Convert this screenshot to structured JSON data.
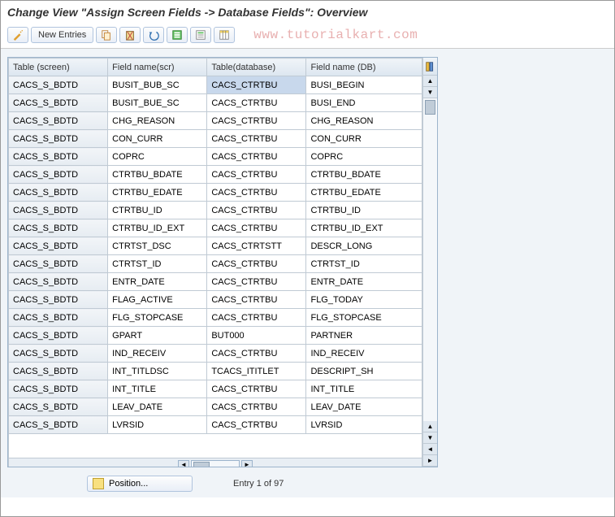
{
  "title": "Change View \"Assign Screen Fields -> Database Fields\": Overview",
  "toolbar": {
    "wand_label": "",
    "new_entries_label": "New Entries"
  },
  "watermark": "www.tutorialkart.com",
  "columns": {
    "c0": "Table (screen)",
    "c1": "Field name(scr)",
    "c2": "Table(database)",
    "c3": "Field name (DB)"
  },
  "selected_cell": {
    "row": 0,
    "col": 2
  },
  "rows": [
    {
      "c0": "CACS_S_BDTD",
      "c1": "BUSIT_BUB_SC",
      "c2": "CACS_CTRTBU",
      "c3": "BUSI_BEGIN"
    },
    {
      "c0": "CACS_S_BDTD",
      "c1": "BUSIT_BUE_SC",
      "c2": "CACS_CTRTBU",
      "c3": "BUSI_END"
    },
    {
      "c0": "CACS_S_BDTD",
      "c1": "CHG_REASON",
      "c2": "CACS_CTRTBU",
      "c3": "CHG_REASON"
    },
    {
      "c0": "CACS_S_BDTD",
      "c1": "CON_CURR",
      "c2": "CACS_CTRTBU",
      "c3": "CON_CURR"
    },
    {
      "c0": "CACS_S_BDTD",
      "c1": "COPRC",
      "c2": "CACS_CTRTBU",
      "c3": "COPRC"
    },
    {
      "c0": "CACS_S_BDTD",
      "c1": "CTRTBU_BDATE",
      "c2": "CACS_CTRTBU",
      "c3": "CTRTBU_BDATE"
    },
    {
      "c0": "CACS_S_BDTD",
      "c1": "CTRTBU_EDATE",
      "c2": "CACS_CTRTBU",
      "c3": "CTRTBU_EDATE"
    },
    {
      "c0": "CACS_S_BDTD",
      "c1": "CTRTBU_ID",
      "c2": "CACS_CTRTBU",
      "c3": "CTRTBU_ID"
    },
    {
      "c0": "CACS_S_BDTD",
      "c1": "CTRTBU_ID_EXT",
      "c2": "CACS_CTRTBU",
      "c3": "CTRTBU_ID_EXT"
    },
    {
      "c0": "CACS_S_BDTD",
      "c1": "CTRTST_DSC",
      "c2": "CACS_CTRTSTT",
      "c3": "DESCR_LONG"
    },
    {
      "c0": "CACS_S_BDTD",
      "c1": "CTRTST_ID",
      "c2": "CACS_CTRTBU",
      "c3": "CTRTST_ID"
    },
    {
      "c0": "CACS_S_BDTD",
      "c1": "ENTR_DATE",
      "c2": "CACS_CTRTBU",
      "c3": "ENTR_DATE"
    },
    {
      "c0": "CACS_S_BDTD",
      "c1": "FLAG_ACTIVE",
      "c2": "CACS_CTRTBU",
      "c3": "FLG_TODAY"
    },
    {
      "c0": "CACS_S_BDTD",
      "c1": "FLG_STOPCASE",
      "c2": "CACS_CTRTBU",
      "c3": "FLG_STOPCASE"
    },
    {
      "c0": "CACS_S_BDTD",
      "c1": "GPART",
      "c2": "BUT000",
      "c3": "PARTNER"
    },
    {
      "c0": "CACS_S_BDTD",
      "c1": "IND_RECEIV",
      "c2": "CACS_CTRTBU",
      "c3": "IND_RECEIV"
    },
    {
      "c0": "CACS_S_BDTD",
      "c1": "INT_TITLDSC",
      "c2": "TCACS_ITITLET",
      "c3": "DESCRIPT_SH"
    },
    {
      "c0": "CACS_S_BDTD",
      "c1": "INT_TITLE",
      "c2": "CACS_CTRTBU",
      "c3": "INT_TITLE"
    },
    {
      "c0": "CACS_S_BDTD",
      "c1": "LEAV_DATE",
      "c2": "CACS_CTRTBU",
      "c3": "LEAV_DATE"
    },
    {
      "c0": "CACS_S_BDTD",
      "c1": "LVRSID",
      "c2": "CACS_CTRTBU",
      "c3": "LVRSID"
    }
  ],
  "footer": {
    "position_label": "Position...",
    "entry_text": "Entry 1 of 97"
  }
}
